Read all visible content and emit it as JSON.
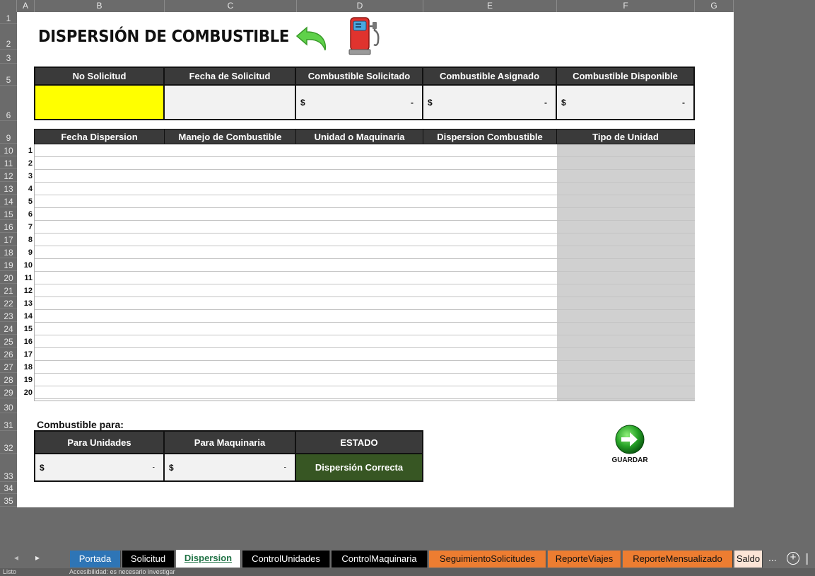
{
  "columns": [
    "A",
    "B",
    "C",
    "D",
    "E",
    "F",
    "G"
  ],
  "rows": [
    "1",
    "2",
    "3",
    "5",
    "6",
    "9",
    "10",
    "11",
    "12",
    "13",
    "14",
    "15",
    "16",
    "17",
    "18",
    "19",
    "20",
    "21",
    "22",
    "23",
    "24",
    "25",
    "26",
    "27",
    "28",
    "29",
    "30",
    "31",
    "32",
    "33",
    "34",
    "35"
  ],
  "title": "DISPERSIÓN DE COMBUSTIBLE",
  "icons": {
    "back": "back-arrow-icon",
    "fuel": "fuel-pump-icon",
    "save": "save-arrow-icon"
  },
  "summary": {
    "headers": [
      "No Solicitud",
      "Fecha de Solicitud",
      "Combustible Solicitado",
      "Combustible Asignado",
      "Combustible Disponible"
    ],
    "values": {
      "no_solicitud": "",
      "fecha": "",
      "solicitado": {
        "cur": "$",
        "amt": "-"
      },
      "asignado": {
        "cur": "$",
        "amt": "-"
      },
      "disponible": {
        "cur": "$",
        "amt": "-"
      }
    },
    "highlight_color": "#ffff00"
  },
  "detail": {
    "headers": [
      "Fecha Dispersion",
      "Manejo de Combustible",
      "Unidad o Maquinaria",
      "Dispersion Combustible",
      "Tipo de Unidad"
    ],
    "row_numbers": [
      "1",
      "2",
      "3",
      "4",
      "5",
      "6",
      "7",
      "8",
      "9",
      "10",
      "11",
      "12",
      "13",
      "14",
      "15",
      "16",
      "17",
      "18",
      "19",
      "20"
    ]
  },
  "combustible_para": {
    "label": "Combustible para:",
    "headers": [
      "Para Unidades",
      "Para Maquinaria",
      "ESTADO"
    ],
    "unidades": {
      "cur": "$",
      "amt": "-"
    },
    "maquinaria": {
      "cur": "$",
      "amt": "-"
    },
    "estado": "Dispersión Correcta",
    "estado_color": "#375623"
  },
  "save_label": "GUARDAR",
  "tabs": [
    {
      "label": "Portada",
      "bg": "#2e75b6",
      "fg": "#ffffff"
    },
    {
      "label": "Solicitud",
      "bg": "#000000",
      "fg": "#ffffff"
    },
    {
      "label": "Dispersion",
      "bg": "#ffffff",
      "fg": "#217346",
      "active": true
    },
    {
      "label": "ControlUnidades",
      "bg": "#000000",
      "fg": "#ffffff"
    },
    {
      "label": "ControlMaquinaria",
      "bg": "#000000",
      "fg": "#ffffff"
    },
    {
      "label": "SeguimientoSolicitudes",
      "bg": "#ed7d31",
      "fg": "#111111"
    },
    {
      "label": "ReporteViajes",
      "bg": "#ed7d31",
      "fg": "#111111"
    },
    {
      "label": "ReporteMensualizado",
      "bg": "#ed7d31",
      "fg": "#111111"
    },
    {
      "label": "Saldo",
      "bg": "#fce4d6",
      "fg": "#111111"
    }
  ],
  "tab_more": "...",
  "status_text": "Accesibilidad: es necesario investigar",
  "status_mode": "Listo"
}
